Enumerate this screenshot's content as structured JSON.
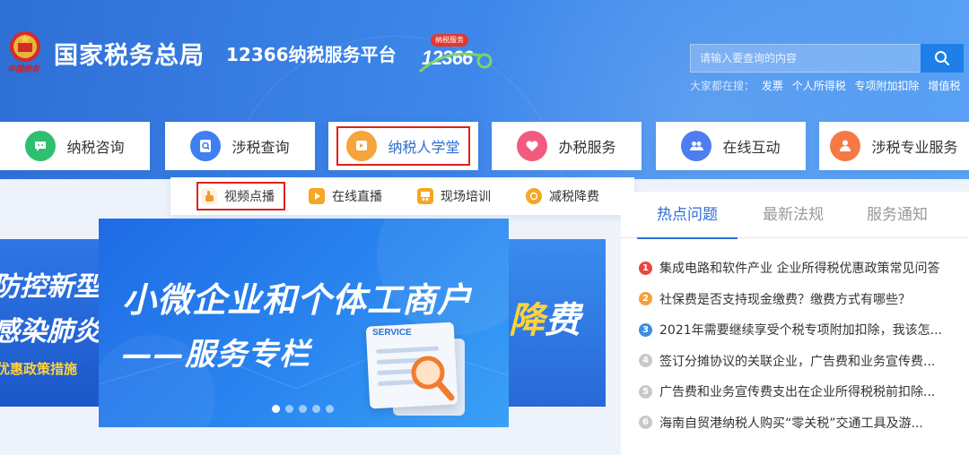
{
  "header": {
    "emblem_text": "中国税务",
    "site_title": "国家税务总局",
    "platform_title": "12366纳税服务平台",
    "hotline": {
      "badge": "纳税服务",
      "number": "12366"
    },
    "search": {
      "placeholder": "请输入要查询的内容"
    },
    "hot_search": {
      "label": "大家都在搜：",
      "items": [
        "发票",
        "个人所得税",
        "专项附加扣除",
        "增值税"
      ]
    }
  },
  "nav": {
    "tabs": [
      {
        "label": "纳税咨询",
        "icon": "chat-icon",
        "color": "#2fbf71"
      },
      {
        "label": "涉税查询",
        "icon": "search-doc-icon",
        "color": "#3f7ff0"
      },
      {
        "label": "纳税人学堂",
        "icon": "book-icon",
        "color": "#f5a53c",
        "active": true
      },
      {
        "label": "办税服务",
        "icon": "heart-icon",
        "color": "#f25b7e"
      },
      {
        "label": "在线互动",
        "icon": "users-icon",
        "color": "#4d7df0"
      },
      {
        "label": "涉税专业服务",
        "icon": "person-group-icon",
        "color": "#f47a45"
      }
    ]
  },
  "submenu": {
    "items": [
      {
        "label": "视频点播",
        "icon": "hand-tap-icon",
        "color": "#f39a2b",
        "highlighted": true
      },
      {
        "label": "在线直播",
        "icon": "video-play-icon",
        "color": "#f5a623"
      },
      {
        "label": "现场培训",
        "icon": "classroom-icon",
        "color": "#f5a623"
      },
      {
        "label": "减税降费",
        "icon": "coin-icon",
        "color": "#f5a623"
      }
    ]
  },
  "banners": {
    "left": {
      "line1": "防控新型冠",
      "line2": "感染肺炎",
      "line3": "优惠政策措施"
    },
    "main": {
      "title_line1": "小微企业和个体工商户",
      "title_line2": "——服务专栏",
      "tag": "SERVICE",
      "slide_count": 5,
      "active_slide": 1
    },
    "right": {
      "text_prefix": "降",
      "text_suffix": "费"
    }
  },
  "news": {
    "tabs": [
      "热点问题",
      "最新法规",
      "服务通知"
    ],
    "active_tab": 0,
    "items": [
      {
        "num": "1",
        "text": "集成电路和软件产业 企业所得税优惠政策常见问答",
        "color": "#e8483c"
      },
      {
        "num": "2",
        "text": "社保费是否支持现金缴费？缴费方式有哪些？",
        "color": "#f3a03a"
      },
      {
        "num": "3",
        "text": "2021年需要继续享受个税专项附加扣除，我该怎...",
        "color": "#3a8ee6"
      },
      {
        "num": "4",
        "text": "签订分摊协议的关联企业，广告费和业务宣传费...",
        "color": "#c8c8c8"
      },
      {
        "num": "5",
        "text": "广告费和业务宣传费支出在企业所得税税前扣除...",
        "color": "#c8c8c8"
      },
      {
        "num": "6",
        "text": "海南自贸港纳税人购买“零关税”交通工具及游...",
        "color": "#c8c8c8"
      }
    ]
  }
}
